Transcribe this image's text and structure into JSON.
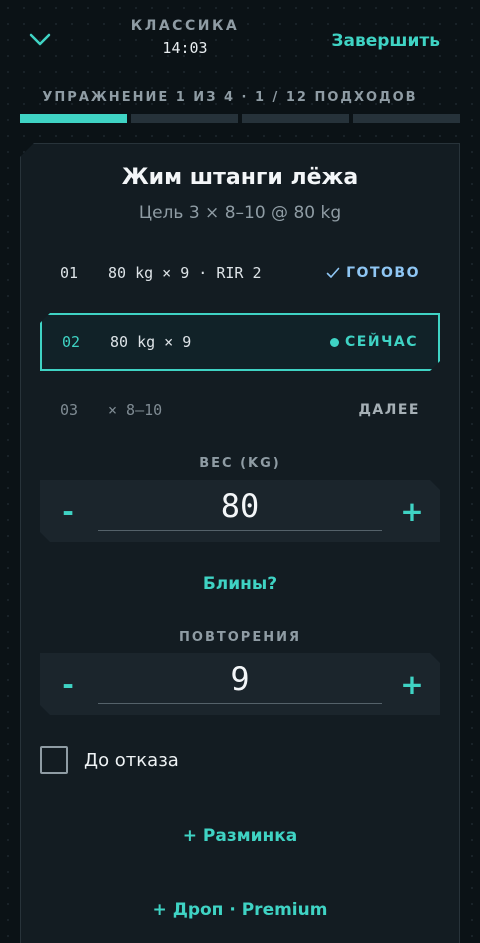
{
  "header": {
    "workout_name": "КЛАССИКА",
    "elapsed": "14:03",
    "finish_label": "Завершить"
  },
  "progress": {
    "label": "УПРАЖНЕНИЕ 1 ИЗ 4 · 1 / 12 ПОДХОДОВ",
    "segments": 4,
    "active_segment": 1
  },
  "exercise": {
    "title": "Жим штанги лёжа",
    "target": "Цель 3 × 8–10 @ 80 kg"
  },
  "sets": [
    {
      "num": "01",
      "value": "80 kg × 9 · RIR 2",
      "status": "ГОТОВО",
      "status_icon": "check-icon"
    },
    {
      "num": "02",
      "value": "80 kg × 9",
      "status": "СЕЙЧАС",
      "status_icon": "dot-icon"
    },
    {
      "num": "03",
      "value": "× 8–10",
      "status": "ДАЛЕЕ"
    }
  ],
  "weight": {
    "label": "ВЕС (KG)",
    "value": "80",
    "minus": "-",
    "plus": "+"
  },
  "plates_link": "Блины?",
  "reps": {
    "label": "ПОВТОРЕНИЯ",
    "value": "9",
    "minus": "-",
    "plus": "+"
  },
  "to_failure": {
    "label": "До отказа",
    "checked": false
  },
  "actions": {
    "warmup": "+ Разминка",
    "drop": "+ Дроп · Premium"
  },
  "colors": {
    "background": "#0b1216",
    "card": "#131c22",
    "accent": "#3fd3c4",
    "done": "#8fc6f4",
    "muted": "#8f9ca4"
  }
}
